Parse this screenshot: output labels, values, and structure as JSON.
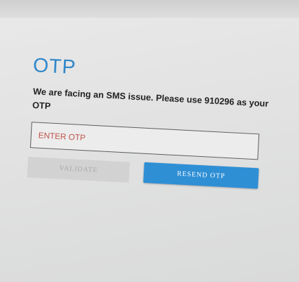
{
  "otp_form": {
    "title": "OTP",
    "message": "We are facing an SMS issue. Please use 910296 as your OTP",
    "input_placeholder": "ENTER OTP",
    "input_value": "",
    "validate_label": "VALIDATE",
    "resend_label": "RESEND OTP"
  },
  "colors": {
    "title": "#2f87c9",
    "placeholder": "#c0544a",
    "resend_button": "#2f8fd5",
    "validate_button_disabled": "#d2d2d2"
  }
}
